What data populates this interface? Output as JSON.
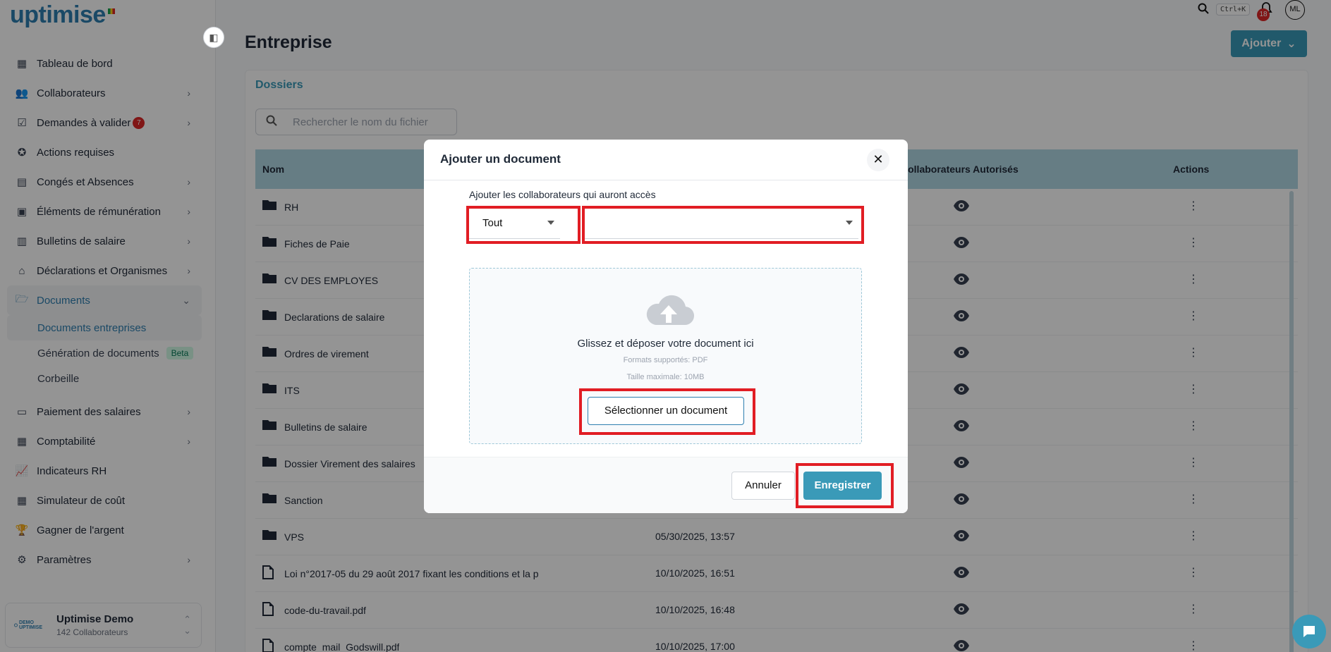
{
  "app": {
    "logo_text": "uptimise"
  },
  "sidebar": {
    "items": [
      {
        "label": "Tableau de bord",
        "icon": "grid-icon",
        "chevron": false
      },
      {
        "label": "Collaborateurs",
        "icon": "users-icon",
        "chevron": true
      },
      {
        "label": "Demandes à valider",
        "icon": "checklist-icon",
        "chevron": true,
        "badge": "7"
      },
      {
        "label": "Actions requises",
        "icon": "badge-check-icon",
        "chevron": false
      },
      {
        "label": "Congés et Absences",
        "icon": "calendar-icon",
        "chevron": true
      },
      {
        "label": "Éléments de rémunération",
        "icon": "id-card-icon",
        "chevron": true
      },
      {
        "label": "Bulletins de salaire",
        "icon": "receipt-icon",
        "chevron": true
      },
      {
        "label": "Déclarations et Organismes",
        "icon": "building-icon",
        "chevron": true
      },
      {
        "label": "Documents",
        "icon": "folder-open-icon",
        "chevron": true,
        "active": true
      }
    ],
    "sub_items": [
      {
        "label": "Documents entreprises",
        "active": true
      },
      {
        "label": "Génération de documents",
        "tag": "Beta"
      },
      {
        "label": "Corbeille"
      }
    ],
    "items2": [
      {
        "label": "Paiement des salaires",
        "icon": "card-icon",
        "chevron": true
      },
      {
        "label": "Comptabilité",
        "icon": "calculator-icon",
        "chevron": true
      },
      {
        "label": "Indicateurs RH",
        "icon": "chart-icon",
        "chevron": false
      },
      {
        "label": "Simulateur de coût",
        "icon": "calculator-icon",
        "chevron": false
      },
      {
        "label": "Gagner de l'argent",
        "icon": "trophy-icon",
        "chevron": false
      },
      {
        "label": "Paramètres",
        "icon": "gear-icon",
        "chevron": true
      }
    ],
    "org": {
      "name": "Uptimise Demo",
      "count": "142 Collaborateurs",
      "logo_text": "DEMO UPTIMISE"
    }
  },
  "topbar": {
    "shortcut": "Ctrl+K",
    "notifications": "18",
    "avatar": "ML"
  },
  "page": {
    "title": "Entreprise",
    "add_label": "Ajouter",
    "tab": "Dossiers",
    "search_placeholder": "Rechercher le nom du fichier"
  },
  "table": {
    "col_name": "Nom",
    "col_auth": "Collaborateurs Autorisés",
    "col_actions": "Actions",
    "rows": [
      {
        "name": "RH",
        "type": "folder",
        "date": ""
      },
      {
        "name": "Fiches de Paie",
        "type": "folder",
        "date": ""
      },
      {
        "name": "CV DES EMPLOYES",
        "type": "folder",
        "date": ""
      },
      {
        "name": "Declarations de salaire",
        "type": "folder",
        "date": ""
      },
      {
        "name": "Ordres de virement",
        "type": "folder",
        "date": ""
      },
      {
        "name": "ITS",
        "type": "folder",
        "date": ""
      },
      {
        "name": "Bulletins de salaire",
        "type": "folder",
        "date": ""
      },
      {
        "name": "Dossier Virement des salaires",
        "type": "folder",
        "date": ""
      },
      {
        "name": "Sanction",
        "type": "folder",
        "date": ""
      },
      {
        "name": "VPS",
        "type": "folder",
        "date": "05/30/2025, 13:57"
      },
      {
        "name": "Loi n°2017-05 du 29 août 2017 fixant les conditions et la p",
        "type": "file",
        "date": "10/10/2025, 16:51"
      },
      {
        "name": "code-du-travail.pdf",
        "type": "file",
        "date": "10/10/2025, 16:48"
      },
      {
        "name": "compte_mail_Godswill.pdf",
        "type": "file",
        "date": "10/10/2025, 17:00"
      }
    ]
  },
  "modal": {
    "title": "Ajouter un document",
    "access_label": "Ajouter les collaborateurs qui auront accès",
    "scope_value": "Tout",
    "collaborators_value": "",
    "drop_title": "Glissez et déposer votre document ici",
    "formats": "Formats supportés: PDF",
    "max_size": "Taille maximale: 10MB",
    "select_label": "Sélectionner un document",
    "cancel_label": "Annuler",
    "save_label": "Enregistrer"
  },
  "colors": {
    "accent": "#3a9ab8",
    "highlight": "#e11d24",
    "header_bg": "#b0d8e4"
  }
}
